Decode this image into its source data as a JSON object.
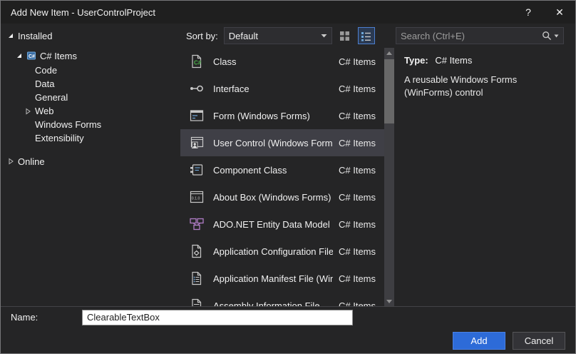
{
  "colors": {
    "accent_blue": "#2D6BD8",
    "selection_gray": "#3F3F46",
    "dialog_background": "#252526",
    "titlebar_background": "#1F1F1F",
    "csharp_green": "#4CB04A",
    "entity_purple": "#B07CC6"
  },
  "titlebar": {
    "title": "Add New Item - UserControlProject",
    "help": "?",
    "close": "✕"
  },
  "sidebar": {
    "items": [
      {
        "label": "Installed"
      },
      {
        "label": "C# Items"
      },
      {
        "label": "Code"
      },
      {
        "label": "Data"
      },
      {
        "label": "General"
      },
      {
        "label": "Web"
      },
      {
        "label": "Windows Forms"
      },
      {
        "label": "Extensibility"
      },
      {
        "label": "Online"
      }
    ]
  },
  "toolbar": {
    "sort_label": "Sort by:",
    "sort_value": "Default",
    "search_placeholder": "Search (Ctrl+E)"
  },
  "templates": {
    "items": [
      {
        "name": "Class",
        "category": "C# Items"
      },
      {
        "name": "Interface",
        "category": "C# Items"
      },
      {
        "name": "Form (Windows Forms)",
        "category": "C# Items"
      },
      {
        "name": "User Control (Windows Forms)",
        "category": "C# Items"
      },
      {
        "name": "Component Class",
        "category": "C# Items"
      },
      {
        "name": "About Box (Windows Forms)",
        "category": "C# Items"
      },
      {
        "name": "ADO.NET Entity Data Model",
        "category": "C# Items"
      },
      {
        "name": "Application Configuration File",
        "category": "C# Items"
      },
      {
        "name": "Application Manifest File (Win...",
        "category": "C# Items"
      },
      {
        "name": "Assembly Information File",
        "category": "C# Items"
      }
    ]
  },
  "info": {
    "type_label": "Type:",
    "type_value": "C# Items",
    "description": "A reusable Windows Forms (WinForms) control"
  },
  "footer": {
    "name_label": "Name:",
    "name_value": "ClearableTextBox",
    "add": "Add",
    "cancel": "Cancel"
  }
}
